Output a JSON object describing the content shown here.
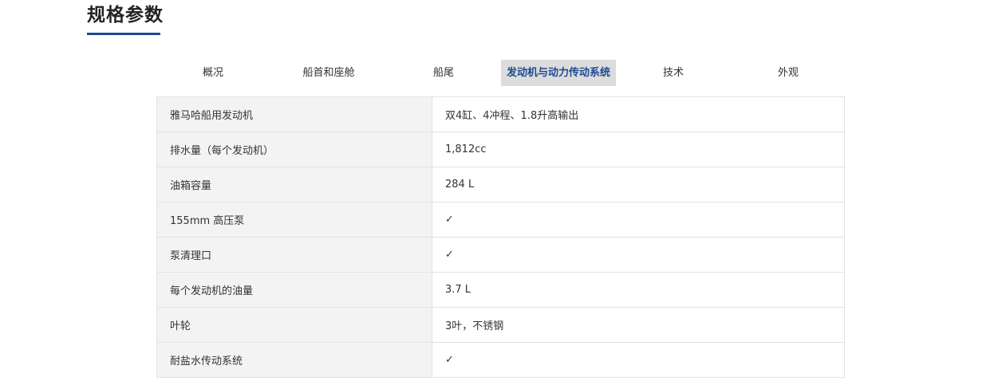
{
  "section_title": "规格参数",
  "tabs": [
    {
      "label": "概况",
      "active": false
    },
    {
      "label": "船首和座舱",
      "active": false
    },
    {
      "label": "船尾",
      "active": false
    },
    {
      "label": "发动机与动力传动系统",
      "active": true
    },
    {
      "label": "技术",
      "active": false
    },
    {
      "label": "外观",
      "active": false
    }
  ],
  "specs": [
    {
      "label": "雅马哈船用发动机",
      "value": "双4缸、4冲程、1.8升高输出"
    },
    {
      "label": "排水量（每个发动机）",
      "value": "1,812cc"
    },
    {
      "label": "油箱容量",
      "value": "284 L"
    },
    {
      "label": "155mm 高压泵",
      "value": "✓"
    },
    {
      "label": "泵清理口",
      "value": "✓"
    },
    {
      "label": "每个发动机的油量",
      "value": "3.7 L"
    },
    {
      "label": "叶轮",
      "value": "3叶，不锈钢"
    },
    {
      "label": "耐盐水传动系统",
      "value": "✓"
    }
  ],
  "colors": {
    "accent": "#1d4a93",
    "active_tab_bg": "#dcdcdc",
    "label_cell_bg": "#f3f3f3"
  }
}
